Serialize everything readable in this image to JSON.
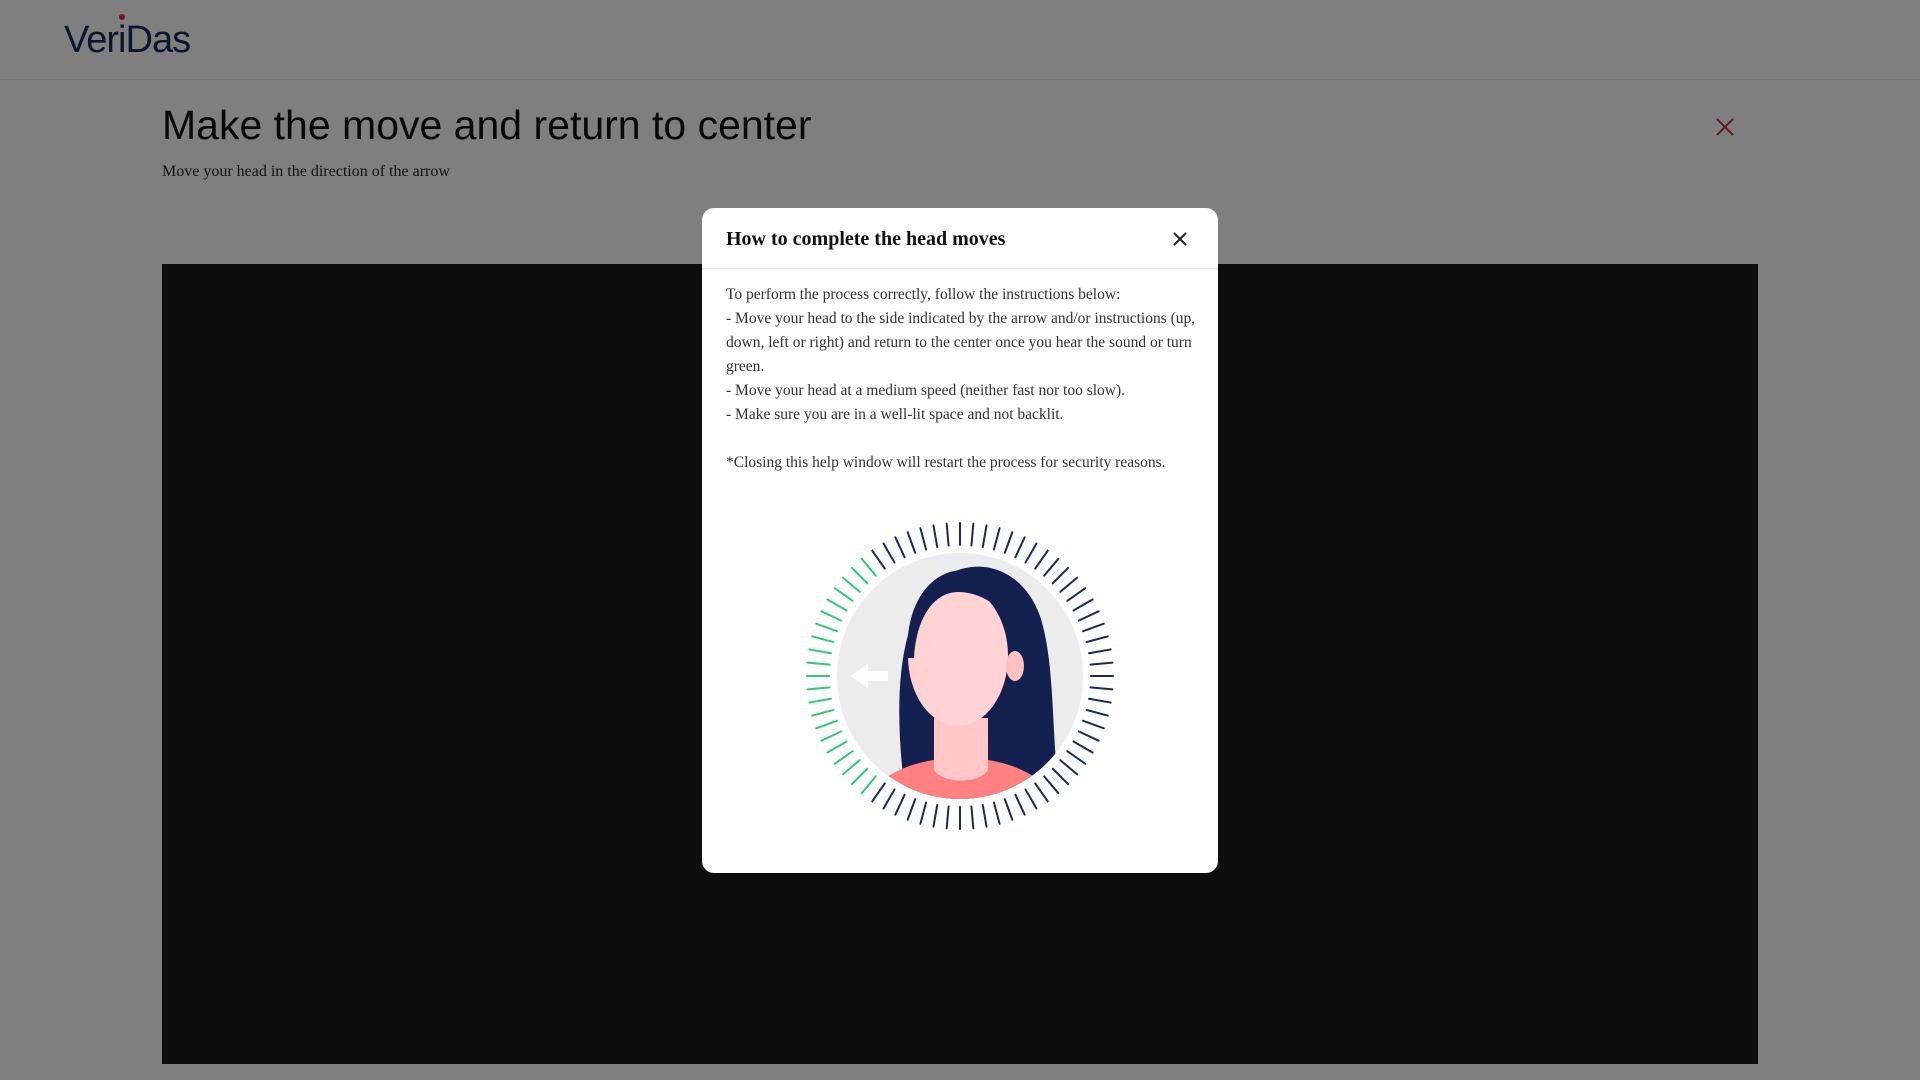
{
  "header": {
    "logo_text": "VeriDas",
    "logo_part1": "Ver",
    "logo_part2": "i",
    "logo_part3": "Das"
  },
  "page": {
    "title": "Make the move and return to center",
    "subtitle": "Move your head in the direction of the arrow",
    "close_icon": "close-icon",
    "accent_color": "#c0394a"
  },
  "modal": {
    "title": "How to complete the head moves",
    "close_icon": "close-icon",
    "intro": "To perform the process correctly, follow the instructions below:",
    "instructions": [
      "- Move your head to the side indicated by the arrow and/or instructions (up, down, left or right) and return to the center once you hear the sound or turn green.",
      "- Move your head at a medium speed (neither fast nor too slow).",
      "- Make sure you are in a well-lit space and not backlit."
    ],
    "note": "*Closing this help window will restart the process for security reasons.",
    "illustration": {
      "icon": "head-move-left-illustration",
      "arrow_icon": "arrow-left-icon",
      "progress_color": "#2ecc71",
      "tick_color": "#1b2a5c"
    }
  }
}
